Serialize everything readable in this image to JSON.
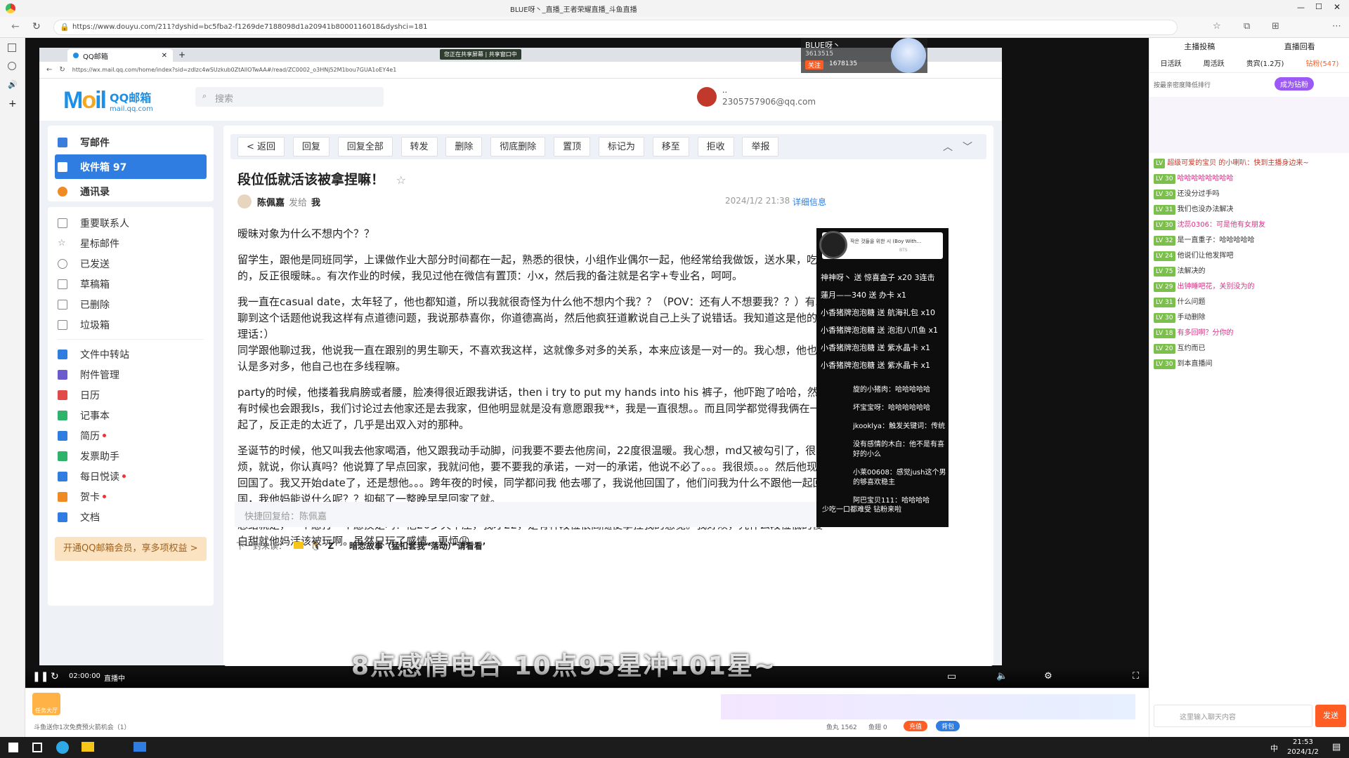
{
  "outer_browser": {
    "title": "BLUE呀丶_直播_王者荣耀直播_斗鱼直播",
    "url": "https://www.douyu.com/211?dyshid=bc5fba2-f1269de7188098d1a20941b8000116018&dyshci=181"
  },
  "inner_browser": {
    "tab_title": "QQ邮箱",
    "url": "https://wx.mail.qq.com/home/index?sid=zdlzc4wSUzkub0ZtAllOTwAA#/read/ZC0002_o3HNj52M1bou7GUA1oEY4e1",
    "share_status_1": "您正在共享屏幕",
    "share_status_2": "共享窗口中"
  },
  "mail": {
    "logo_text": "QQ邮箱",
    "logo_sub": "mail.qq.com",
    "search_placeholder": "搜索",
    "user_name": "..",
    "user_email": "2305757906@qq.com",
    "compose": "写邮件",
    "inbox": "收件箱 97",
    "contacts": "通讯录",
    "folders": [
      "重要联系人",
      "星标邮件",
      "已发送",
      "草稿箱",
      "已删除",
      "垃圾箱"
    ],
    "apps": [
      "文件中转站",
      "附件管理",
      "日历",
      "记事本",
      "简历",
      "发票助手",
      "每日悦读",
      "贺卡",
      "文档"
    ],
    "vip_banner": "开通QQ邮箱会员，享多项权益 >",
    "toolbar": [
      "< 返回",
      "回复",
      "回复全部",
      "转发",
      "删除",
      "彻底删除",
      "置顶",
      "标记为",
      "移至",
      "拒收",
      "举报"
    ],
    "subject": "段位低就活该被拿捏嘛！",
    "sender": "陈佩嘉",
    "sent_to_label": "发给",
    "recipient": "我",
    "date": "2024/1/2 21:38",
    "details": "详细信息",
    "body": [
      "暧昧对象为什么不想内个？？",
      "留学生，跟他是同班同学，上课做作业大部分时间都在一起，熟悉的很快，小组作业偶尔一起，他经常给我做饭，送水果，吃的，反正很暧昧。。有次作业的时候，我见过他在微信有置顶：小x，然后我的备注就是名字+专业名，呵呵。",
      "我一直在casual date，太年轻了，他也都知道，所以我就很奇怪为什么他不想内个我？？（POV：还有人不想要我？？）有次聊到这个话题他说我这样有点道德问题，我说那恭喜你，你道德高尚，然后他疯狂道歉说自己上头了说错话。我知道这是他的心理话：）\n同学跟他聊过我，他说我一直在跟别的男生聊天，不喜欢我这样，这就像多对多的关系，本来应该是一对一的。我心想，他也承认是多对多，他自己也在多线程嘛。",
      "party的时候，他搂着我肩膀或者腰，脸凑得很近跟我讲话，then i try to put my hands into his 裤子，他吓跑了哈哈，然后有时候也会跟我ls，我们讨论过去他家还是去我家，但他明显就是没有意愿跟我**，我是一直很想。。而且同学都觉得我俩在一起了，反正走的太近了，几乎是出双入对的那种。",
      "圣诞节的时候，他又叫我去他家喝酒，他又跟我动手动脚，问我要不要去他房间，22度很温暖。我心想，md又被勾引了，很烦，就说，你认真吗？他说算了早点回家，我就问他，要不要我的承诺，一对一的承诺，他说不必了。。。我很烦。。。然后他现在回国了。我又开始date了，还是想他。。。跨年夜的时候，同学都问我 他去哪了，我说他回国了，他们问我为什么不跟他一起回国，我他妈能说什么呢？？抑郁了一整晚早早回家了就。",
      "总结就是，一个愿打一个愿挨是吗？他26岁天平座，我才22，是有种段位很高随便拿捏我的感觉。我好烦，凭什么段位低的傻白甜就他妈活该被玩啊。虽然只玩了感情，更烦😩"
    ],
    "quick_reply": "快捷回复给：陈佩嘉",
    "next_unread_label": "下一封未读：",
    "next_unread_from": "Z",
    "next_unread_subject": "暗恋故事（猛扣套我“落动）”请看看’"
  },
  "stream": {
    "overlay_text": "8点感情电台 10点95星冲101星~",
    "time": "02:00:00",
    "live_label": "直播中"
  },
  "streamer": {
    "name": "BLUE呀丶",
    "fans": "3613515",
    "follow": "关注",
    "follow_count": "1678135",
    "contribution_tab": "直播回看"
  },
  "music": {
    "song": "작은 것들을 위한 시 (Boy With...",
    "artist": "BTS"
  },
  "gifts": [
    "神神呀丶 送 惊喜盒子 x20 3连击",
    "蓮月——340 送 办卡 x1",
    "小香猪牌泡泡糖 送 航海礼包 x10",
    "小香猪牌泡泡糖 送 泡泡八爪鱼 x1",
    "小香猪牌泡泡糖 送 紫水晶卡 x1",
    "小香猪牌泡泡糖 送 紫水晶卡 x1"
  ],
  "obs_chat": [
    "旋的小猪肉：哈哈哈哈哈",
    "坏宝宝呀：哈哈哈哈哈哈",
    "jkooklya：触发关键词：传统",
    "没有感情的木白：他不是有喜好的小么",
    "小莱00608：感觉jush这个男的够喜欢稳主",
    "阿巴宝贝111：哈哈哈哈"
  ],
  "obs_footer": "少吃一口都难受 钻粉来啦",
  "panel": {
    "tabs": [
      "日活跃",
      "周活跃",
      "贵宾(1.2万)",
      "钻粉(547)"
    ],
    "top_tabs": [
      "主播投稿",
      "直播回看"
    ],
    "rank_text": "按最亲密度降低排行",
    "become_fan": "成为钻粉",
    "chat": [
      "超级可爱的宝贝 的小喇叭：快到主播身边来~",
      "哈哈哈哈哈哈哈哈",
      "还没分过手吗",
      "我们也没办法解决",
      "沈蕊0306：可是他有女朋友",
      "是一直重子：哈哈哈哈哈",
      "他说们让他发挥吧",
      "法解决的",
      "出钟睡吧花，关别没为的",
      "什么问题",
      "手动删除",
      "有多回啊？分你的",
      "互约而已",
      "到本直播间"
    ],
    "input_placeholder": "这里输入聊天内容",
    "send": "发送",
    "fan_club": "粉丝团"
  },
  "bottom": {
    "task_center": "任务大厅",
    "notice": "斗鱼送你1次免费预火箭机会（1）",
    "fish_balls": "鱼丸 1562",
    "fish_wings": "鱼翅 0",
    "recharge": "充值",
    "backpack": "背包"
  },
  "taskbar": {
    "time": "21:53",
    "date": "2024/1/2",
    "lang": "中"
  }
}
